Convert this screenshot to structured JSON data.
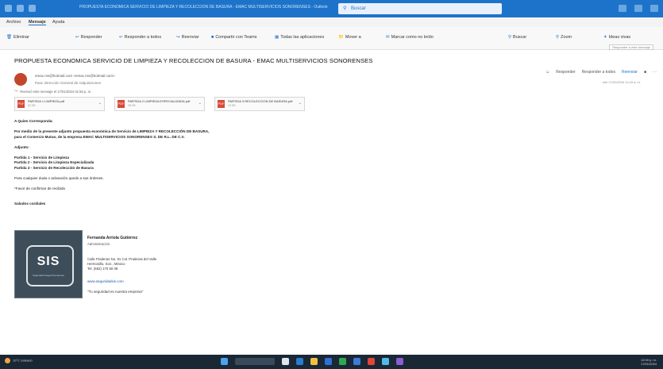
{
  "titlebar": {
    "title": "PROPUESTA ECONOMICA SERVICIO DE LIMPIEZA Y RECOLECCION DE BASURA - EMAC MULTISERVICIOS SONORENSES - Outlook",
    "search_placeholder": "Buscar"
  },
  "menu": {
    "items": [
      "Archivo",
      "Mensaje",
      "Ayuda"
    ]
  },
  "ribbon": {
    "buttons": [
      "Eliminar",
      "Responder",
      "Responder a todos",
      "Reenviar",
      "Compartir con Teams",
      "Todas las aplicaciones",
      "Mover a",
      "Marcar como no leído",
      "Buscar",
      "Zoom",
      "Ideas vivas"
    ],
    "tooltip": "Responder a este mensaje"
  },
  "email": {
    "subject": "PROPUESTA ECONOMICA SERVICIO DE LIMPIEZA Y RECOLECCION DE BASURA - EMAC MULTISERVICIOS SONORENSES",
    "sender": "emac.ms@hotmail.com <emac.ms@hotmail.com>",
    "recipients": "Para: Dirección General de Adquisiciones",
    "forwarded_note": "Reenvió este mensaje el 17/01/2024 01:56 p. m.",
    "date": "mié 17/01/2024 11:43 a. m.",
    "actions": [
      "Responder",
      "Responder a todos",
      "Reenviar"
    ],
    "attachments": [
      {
        "name": "PARTIDA 1 LIMPIEZA.pdf",
        "size": "62 KB"
      },
      {
        "name": "PARTIDA 2 LIMPIEZA ESPECIALIZADA.pdf",
        "size": "48 KB"
      },
      {
        "name": "PARTIDA 3 RECOLECCION DE BASURA.pdf",
        "size": "40 KB"
      }
    ],
    "body": {
      "greeting": "A Quien Corresponda:",
      "intro_1": "Por medio de la presente adjunto propuesta económica de Servicio de LIMPIEZA Y RECOLECCIÓN DE BASURA,",
      "intro_2": "para el Comercio Mutuo, de la empresa EMAC MULTISERVICIOS SONORENSES S. DE R.L. DE C.V.",
      "adjunto": "Adjunto:",
      "partidas": [
        "Partida 1 - Servicio de Limpieza",
        "Partida 2 - Servicio de Limpieza Especializada",
        "Partida 3 - Servicio de Recolección de Basura"
      ],
      "closing": "Para cualquier duda o aclaración quedo a sus órdenes.",
      "favor": "*Favor de confirmar de recibido",
      "saludos": "Saludos cordiales"
    },
    "signature": {
      "logo_text": "SIS",
      "logo_sub": "Seguridad Integral Sonorense",
      "name": "Fernanda Arriola Gutiérrez",
      "role": "Administración",
      "address_1": "Calle Praderas No. 91 Col. Praderas del Valle",
      "address_2": "Hermosillo, Son., México",
      "phone": "Tel. (662) 170 50 08",
      "website": "www.seguridadsis.com",
      "quote": "\"Tu seguridad es nuestra empresa\""
    }
  },
  "taskbar": {
    "weather": "10°C Soleado",
    "time": "12:00 p. m.",
    "date": "17/01/2024"
  },
  "colors": {
    "accent": "#1d73c9",
    "taskbar": "#1a2735",
    "logo_bg": "#3d4d5a"
  }
}
